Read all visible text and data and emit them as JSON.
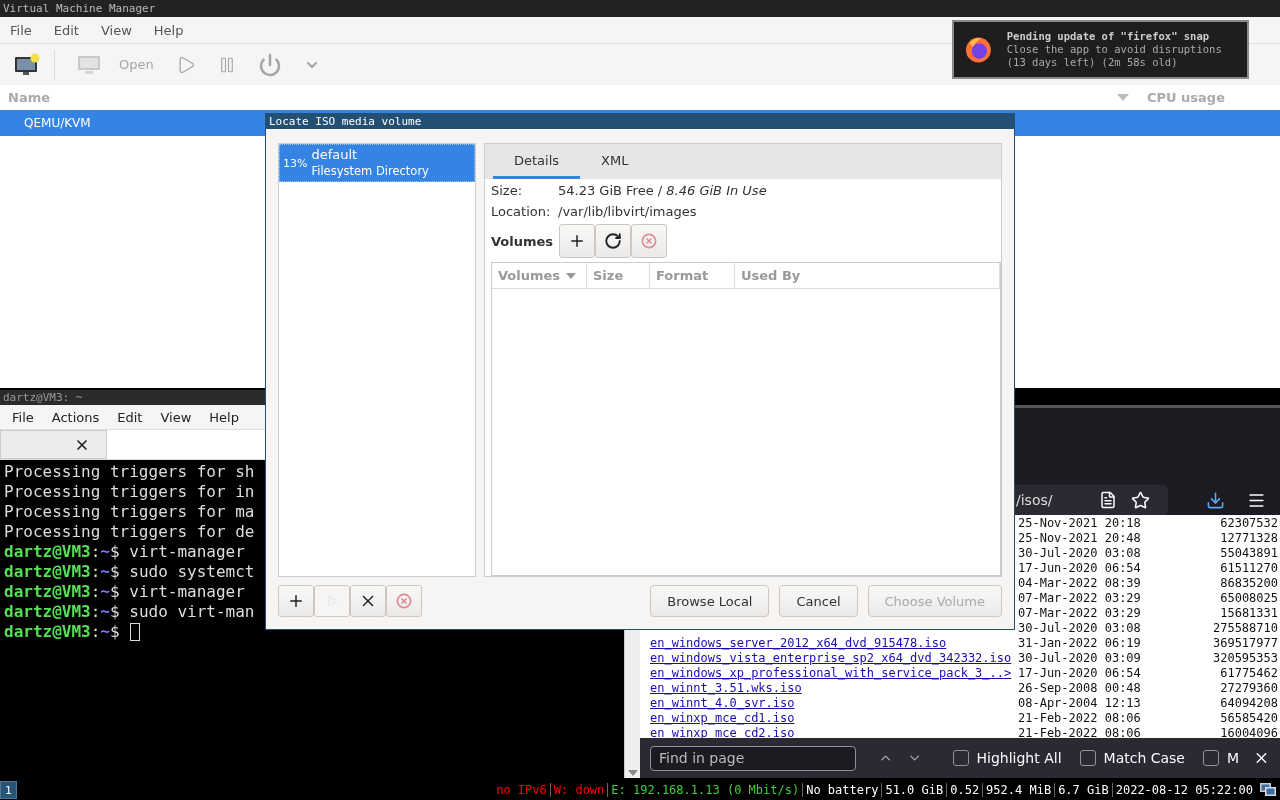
{
  "vmm": {
    "title": "Virtual Machine Manager",
    "menu": [
      "File",
      "Edit",
      "View",
      "Help"
    ],
    "toolbar": [
      {
        "kind": "new-vm",
        "disabled": false
      },
      {
        "kind": "open",
        "label": "Open",
        "disabled": true
      },
      {
        "kind": "run",
        "disabled": true
      },
      {
        "kind": "pause",
        "disabled": true
      },
      {
        "kind": "shutdown",
        "disabled": true
      },
      {
        "kind": "more",
        "disabled": true
      }
    ],
    "columns": [
      {
        "label": "Name",
        "caret": false
      },
      {
        "label": "CPU usage",
        "caret": true
      }
    ],
    "rows": [
      {
        "name": "QEMU/KVM",
        "selected": true
      }
    ]
  },
  "notification": {
    "title": "Pending update of \"firefox\" snap",
    "body": "Close the app to avoid disruptions (13 days left) (2m 58s old)"
  },
  "terminal": {
    "title": "dartz@VM3: ~",
    "menu": [
      "File",
      "Actions",
      "Edit",
      "View",
      "Help"
    ],
    "lines": [
      {
        "kind": "output",
        "text": "Processing triggers for sh"
      },
      {
        "kind": "output",
        "text": "Processing triggers for in"
      },
      {
        "kind": "output",
        "text": "Processing triggers for ma"
      },
      {
        "kind": "output",
        "text": "Processing triggers for de"
      },
      {
        "kind": "prompt",
        "user": "dartz@VM3",
        "sep": ":",
        "path": "~",
        "text": "$ virt-manager",
        "cursor": false
      },
      {
        "kind": "prompt",
        "user": "dartz@VM3",
        "sep": ":",
        "path": "~",
        "text": "$ sudo systemct",
        "cursor": false
      },
      {
        "kind": "prompt",
        "user": "dartz@VM3",
        "sep": ":",
        "path": "~",
        "text": "$ virt-manager",
        "cursor": false
      },
      {
        "kind": "prompt",
        "user": "dartz@VM3",
        "sep": ":",
        "path": "~",
        "text": "$ sudo virt-man",
        "cursor": false
      },
      {
        "kind": "prompt",
        "user": "dartz@VM3",
        "sep": ":",
        "path": "~",
        "text": "$",
        "cursor": true
      }
    ]
  },
  "browser": {
    "url": "/isos/",
    "rows": [
      {
        "date": "25-Nov-2021 20:18",
        "size": "62307532"
      },
      {
        "date": "25-Nov-2021 20:48",
        "size": "12771328"
      },
      {
        "date": "30-Jul-2020 03:08",
        "size": "55043891"
      },
      {
        "date": "17-Jun-2020 06:54",
        "size": "61511270"
      },
      {
        "date": "04-Mar-2022 08:39",
        "size": "86835200"
      },
      {
        "date": "07-Mar-2022 03:29",
        "size": "65008025"
      },
      {
        "date": "07-Mar-2022 03:29",
        "size": "15681331"
      },
      {
        "date": "30-Jul-2020 03:08",
        "size": "275588710"
      },
      {
        "name": "en_windows_server_2012_x64_dvd_915478.iso",
        "date": "31-Jan-2022 06:19",
        "size": "369517977"
      },
      {
        "name": "en_windows_vista_enterprise_sp2_x64_dvd_342332.iso",
        "date": "30-Jul-2020 03:09",
        "size": "320595353"
      },
      {
        "name": "en_windows_xp_professional_with_service_pack_3_..>",
        "date": "17-Jun-2020 06:54",
        "size": "61775462"
      },
      {
        "name": "en_winnt_3.51.wks.iso",
        "date": "26-Sep-2008 00:48",
        "size": "27279360"
      },
      {
        "name": "en_winnt_4.0_svr.iso",
        "date": "08-Apr-2004 12:13",
        "size": "64094208"
      },
      {
        "name": "en_winxp_mce_cd1.iso",
        "date": "21-Feb-2022 08:06",
        "size": "56585420"
      },
      {
        "name": "en_winxp_mce_cd2.iso",
        "date": "21-Feb-2022 08:06",
        "size": "16004096"
      }
    ],
    "find": {
      "placeholder": "Find in page",
      "options": [
        {
          "label": "Highlight All",
          "checked": false
        },
        {
          "label": "Match Case",
          "checked": false
        },
        {
          "label": "M",
          "checked": false
        }
      ]
    }
  },
  "dialog": {
    "title": "Locate ISO media volume",
    "pools": [
      {
        "usage": "13%",
        "name": "default",
        "type": "Filesystem Directory",
        "selected": true
      }
    ],
    "pool_buttons": [
      {
        "kind": "add",
        "disabled": false
      },
      {
        "kind": "start",
        "disabled": true
      },
      {
        "kind": "delete",
        "disabled": false
      },
      {
        "kind": "stop",
        "disabled": false
      }
    ],
    "tabs": [
      {
        "label": "Details",
        "selected": true
      },
      {
        "label": "XML",
        "selected": false
      }
    ],
    "fields": [
      {
        "label": "Size:",
        "value": "54.23 GiB Free / *8.46 GiB In Use*"
      },
      {
        "label": "Location:",
        "value": "/var/lib/libvirt/images"
      }
    ],
    "volumes_label": "Volumes",
    "volume_buttons": [
      {
        "kind": "add",
        "disabled": false
      },
      {
        "kind": "refresh",
        "disabled": false
      },
      {
        "kind": "stop",
        "disabled": false
      }
    ],
    "columns": [
      {
        "label": "Volumes",
        "sorted": true
      },
      {
        "label": "Size",
        "sorted": false
      },
      {
        "label": "Format",
        "sorted": false
      },
      {
        "label": "Used By",
        "sorted": false
      }
    ],
    "buttons": [
      {
        "label": "Browse Local",
        "disabled": false
      },
      {
        "label": "Cancel",
        "disabled": false
      },
      {
        "label": "Choose Volume",
        "disabled": true
      }
    ]
  },
  "statusbar": {
    "workspace": "1",
    "items": [
      {
        "text": "no IPv6",
        "color": "#ff0000"
      },
      {
        "text": "W: down",
        "color": "#ff0000"
      },
      {
        "text": "E: 192.168.1.13 (0 Mbit/s)",
        "color": "#3cd03c"
      },
      {
        "text": "No battery",
        "color": "#ffffff"
      },
      {
        "text": "51.0 GiB",
        "color": "#ffffff"
      },
      {
        "text": "0.52",
        "color": "#ffffff"
      },
      {
        "text": "952.4 MiB",
        "color": "#ffffff"
      },
      {
        "text": "6.7 GiB",
        "color": "#ffffff"
      },
      {
        "text": "2022-08-12 05:22:00",
        "color": "#ffffff"
      }
    ]
  }
}
